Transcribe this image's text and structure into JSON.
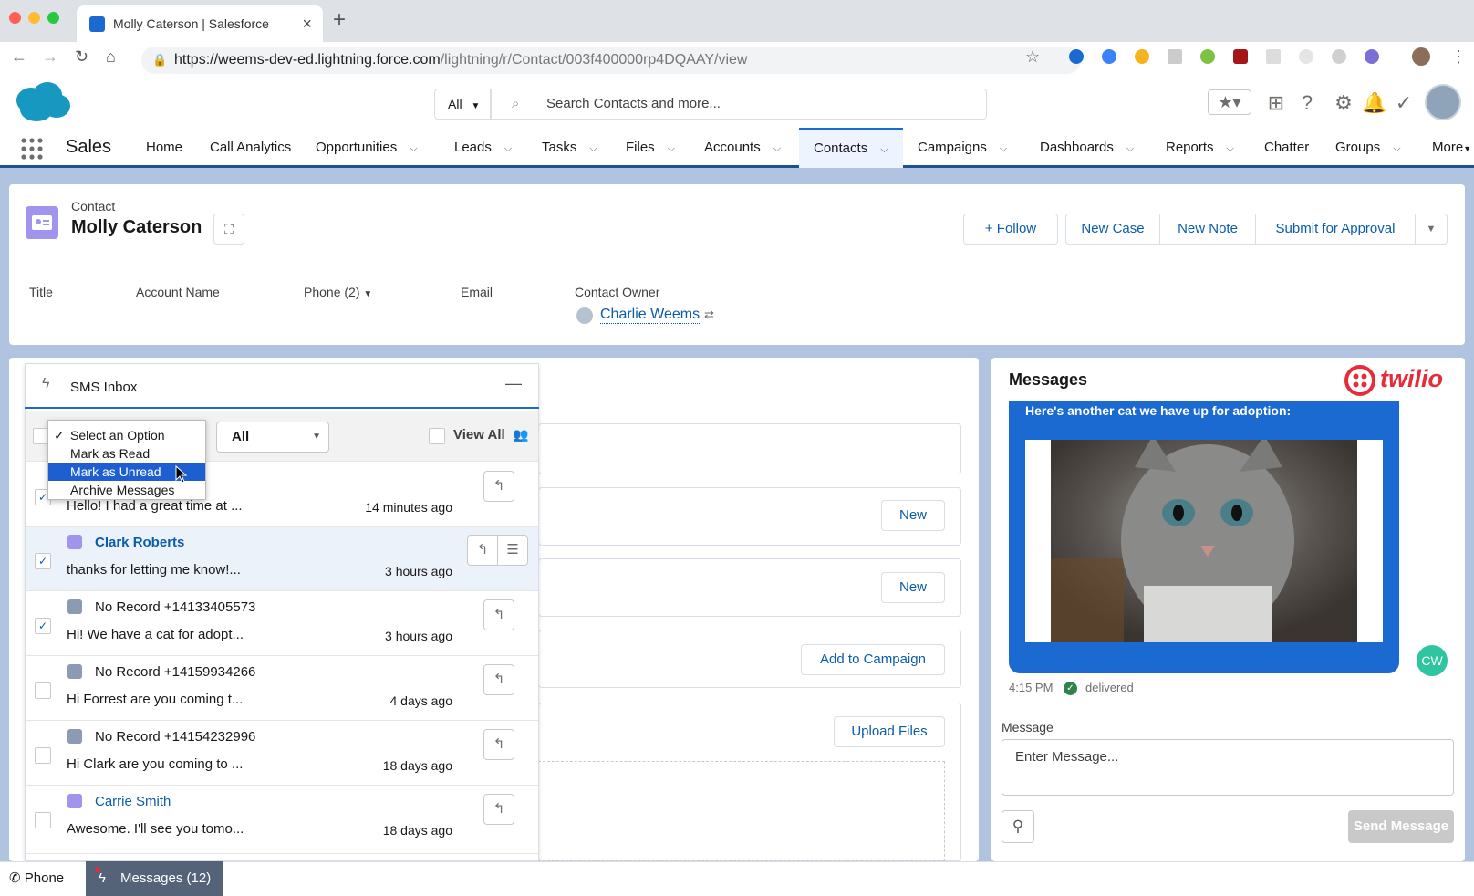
{
  "browser": {
    "tab_title": "Molly Caterson | Salesforce",
    "url_host": "https://weems-dev-ed.lightning.force.com",
    "url_path": "/lightning/r/Contact/003f400000rp4DQAAY/view"
  },
  "header": {
    "search_scope": "All",
    "search_placeholder": "Search Contacts and more..."
  },
  "nav": {
    "app_name": "Sales",
    "items": [
      "Home",
      "Call Analytics",
      "Opportunities",
      "Leads",
      "Tasks",
      "Files",
      "Accounts",
      "Contacts",
      "Campaigns",
      "Dashboards",
      "Reports",
      "Chatter",
      "Groups",
      "More"
    ],
    "active": "Contacts"
  },
  "contact": {
    "type": "Contact",
    "name": "Molly Caterson",
    "actions": [
      "Follow",
      "New Case",
      "New Note",
      "Submit for Approval"
    ],
    "fields": {
      "title": "Title",
      "account": "Account Name",
      "phone": "Phone (2)",
      "email": "Email",
      "owner_label": "Contact Owner",
      "owner": "Charlie Weems"
    }
  },
  "middle": {
    "new1": "New",
    "new2": "New",
    "add_campaign": "Add to Campaign",
    "upload": "Upload Files"
  },
  "sms": {
    "title": "SMS Inbox",
    "filter_value": "All",
    "view_all": "View All",
    "dropdown": {
      "options": [
        "Select an Option",
        "Mark as Read",
        "Mark as Unread",
        "Archive Messages"
      ],
      "checked": "Select an Option",
      "highlighted": "Mark as Unread"
    },
    "rows": [
      {
        "name": "",
        "message": "Hello! I had a great time at ...",
        "time": "14 minutes ago",
        "checked": true
      },
      {
        "name": "Clark Roberts",
        "message": "thanks for letting me know!...",
        "time": "3 hours ago",
        "checked": true
      },
      {
        "name": "No Record +14133405573",
        "message": "Hi! We have a cat for adopt...",
        "time": "3 hours ago",
        "checked": true
      },
      {
        "name": "No Record +14159934266",
        "message": "Hi Forrest are you coming t...",
        "time": "4 days ago",
        "checked": false
      },
      {
        "name": "No Record +14154232996",
        "message": "Hi Clark are you coming to ...",
        "time": "18 days ago",
        "checked": false
      },
      {
        "name": "Carrie Smith",
        "message": "Awesome. I'll see you tomo...",
        "time": "18 days ago",
        "checked": false
      }
    ]
  },
  "messages": {
    "title": "Messages",
    "brand": "twilio",
    "bubble_text": "Here's another cat we have up for adoption:",
    "sender_initials": "CW",
    "time": "4:15 PM",
    "status": "delivered",
    "input_label": "Message",
    "input_placeholder": "Enter Message...",
    "send_label": "Send Message"
  },
  "footer": {
    "phone": "Phone",
    "messages": "Messages (12)"
  },
  "colors": {
    "brand_blue": "#1b6ad1",
    "twilio_red": "#e62b39",
    "header_band": "#b0c4df"
  }
}
